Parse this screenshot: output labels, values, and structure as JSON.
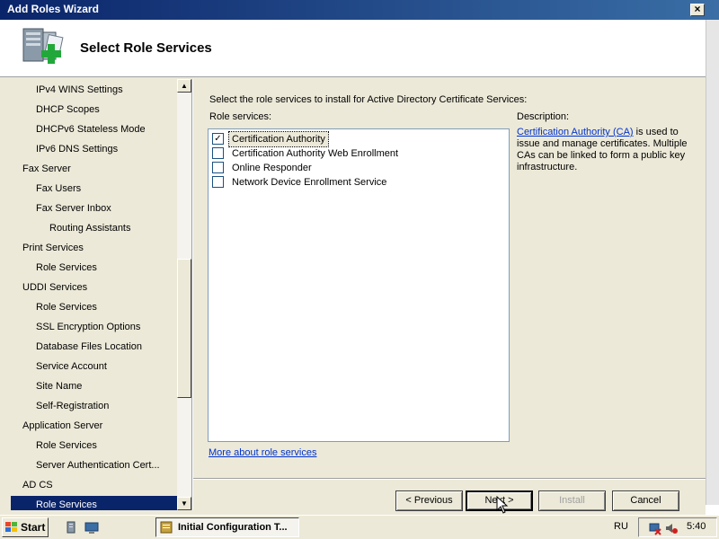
{
  "window": {
    "title": "Add Roles Wizard",
    "close_label": "×"
  },
  "header": {
    "heading": "Select Role Services"
  },
  "nav": {
    "items": [
      {
        "label": "IPv4 WINS Settings",
        "level": 1
      },
      {
        "label": "DHCP Scopes",
        "level": 1
      },
      {
        "label": "DHCPv6 Stateless Mode",
        "level": 1
      },
      {
        "label": "IPv6 DNS Settings",
        "level": 1
      },
      {
        "label": "Fax Server",
        "level": 0
      },
      {
        "label": "Fax Users",
        "level": 1
      },
      {
        "label": "Fax Server Inbox",
        "level": 1
      },
      {
        "label": "Routing Assistants",
        "level": 2
      },
      {
        "label": "Print Services",
        "level": 0
      },
      {
        "label": "Role Services",
        "level": 1
      },
      {
        "label": "UDDI Services",
        "level": 0
      },
      {
        "label": "Role Services",
        "level": 1
      },
      {
        "label": "SSL Encryption Options",
        "level": 1
      },
      {
        "label": "Database Files Location",
        "level": 1
      },
      {
        "label": "Service Account",
        "level": 1
      },
      {
        "label": "Site Name",
        "level": 1
      },
      {
        "label": "Self-Registration",
        "level": 1
      },
      {
        "label": "Application Server",
        "level": 0
      },
      {
        "label": "Role Services",
        "level": 1
      },
      {
        "label": "Server Authentication Cert...",
        "level": 1
      },
      {
        "label": "AD CS",
        "level": 0
      },
      {
        "label": "Role Services",
        "level": 1,
        "selected": true
      }
    ],
    "scroll_up": "▲",
    "scroll_down": "▼"
  },
  "main": {
    "instruction": "Select the role services to install for Active Directory Certificate Services:",
    "role_services_label": "Role services:",
    "description_label": "Description:",
    "role_services": [
      {
        "label": "Certification Authority",
        "checked": true,
        "selected": true
      },
      {
        "label": "Certification Authority Web Enrollment",
        "checked": false
      },
      {
        "label": "Online Responder",
        "checked": false
      },
      {
        "label": "Network Device Enrollment Service",
        "checked": false
      }
    ],
    "description": {
      "link": "Certification Authority (CA)",
      "text": " is used to issue and manage certificates. Multiple CAs can be linked to form a public key infrastructure."
    },
    "more_link": "More about role services"
  },
  "buttons": {
    "previous": "< Previous",
    "next": "Next >",
    "install": "Install",
    "cancel": "Cancel"
  },
  "taskbar": {
    "start": "Start",
    "task": "Initial Configuration T...",
    "language": "RU",
    "clock": "5:40"
  },
  "colors": {
    "selection": "#0a246a",
    "link": "#0033cc",
    "face": "#ece9d8"
  }
}
